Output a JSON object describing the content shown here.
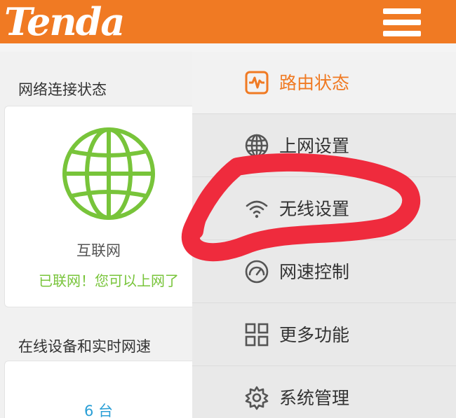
{
  "header": {
    "logo_text": "Tenda",
    "brand_color": "#f07a23",
    "menu_icon": "hamburger-menu-icon"
  },
  "network_status": {
    "title": "网络连接状态",
    "icon": "globe-icon",
    "internet_label": "互联网",
    "status_text": "已联网！您可以上网了",
    "status_color": "#78c43a"
  },
  "devices": {
    "title": "在线设备和实时网速",
    "count_value": "6",
    "count_unit": "台",
    "count_color": "#2a9fd6"
  },
  "menu": {
    "items": [
      {
        "label": "路由状态",
        "icon": "activity-chart-icon",
        "active": true
      },
      {
        "label": "上网设置",
        "icon": "globe-icon",
        "active": false
      },
      {
        "label": "无线设置",
        "icon": "wifi-icon",
        "active": false
      },
      {
        "label": "网速控制",
        "icon": "speedometer-icon",
        "active": false
      },
      {
        "label": "更多功能",
        "icon": "grid-icon",
        "active": false
      },
      {
        "label": "系统管理",
        "icon": "gear-icon",
        "active": false
      }
    ]
  },
  "annotation": {
    "color": "#ef2b3d",
    "target": "无线设置"
  }
}
